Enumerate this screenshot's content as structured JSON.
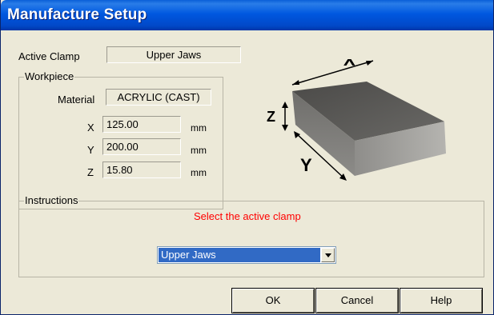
{
  "window": {
    "title": "Manufacture Setup"
  },
  "active_clamp": {
    "label": "Active Clamp",
    "value": "Upper Jaws"
  },
  "workpiece": {
    "group_title": "Workpiece",
    "material_label": "Material",
    "material_value": "ACRYLIC (CAST)",
    "dimensions": [
      {
        "axis": "X",
        "value": "125.00",
        "unit": "mm"
      },
      {
        "axis": "Y",
        "value": "200.00",
        "unit": "mm"
      },
      {
        "axis": "Z",
        "value": "15.80",
        "unit": "mm"
      }
    ]
  },
  "diagram": {
    "x_label": "X",
    "y_label": "Y",
    "z_label": "Z"
  },
  "instructions": {
    "group_title": "Instructions",
    "message": "Select the active clamp",
    "clamp_select_value": "Upper Jaws"
  },
  "buttons": {
    "ok": "OK",
    "cancel": "Cancel",
    "help": "Help"
  },
  "colors": {
    "title_bar": "#0054e3",
    "dialog_bg": "#ece9d8",
    "instruction_text": "#ff0000",
    "selection": "#316ac5"
  }
}
